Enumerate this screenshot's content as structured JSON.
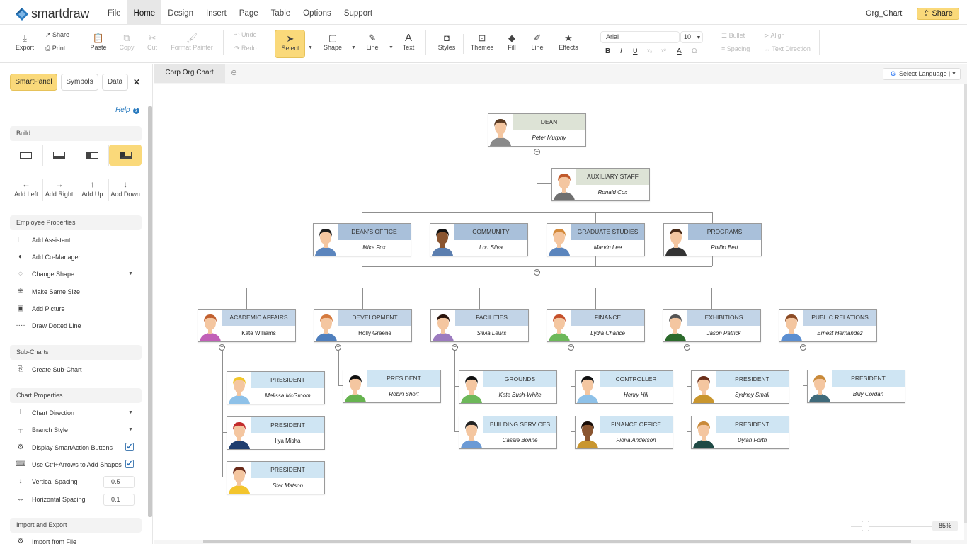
{
  "app": {
    "name": "smartdraw",
    "doc_name": "Org_Chart",
    "share_label": "Share"
  },
  "menu": [
    "File",
    "Home",
    "Design",
    "Insert",
    "Page",
    "Table",
    "Options",
    "Support"
  ],
  "menu_active": "Home",
  "toolbar": {
    "export": "Export",
    "share": "Share",
    "print": "Print",
    "paste": "Paste",
    "copy": "Copy",
    "cut": "Cut",
    "format_painter": "Format Painter",
    "undo": "Undo",
    "redo": "Redo",
    "select": "Select",
    "shape": "Shape",
    "line": "Line",
    "text": "Text",
    "styles": "Styles",
    "themes": "Themes",
    "fill": "Fill",
    "line2": "Line",
    "effects": "Effects",
    "font": "Arial",
    "font_size": "10",
    "bullet": "Bullet",
    "align": "Align",
    "spacing": "Spacing",
    "text_direction": "Text Direction"
  },
  "side": {
    "tabs": [
      "SmartPanel",
      "Symbols",
      "Data"
    ],
    "help": "Help",
    "build_label": "Build",
    "add_buttons": [
      "Add Left",
      "Add Right",
      "Add Up",
      "Add Down"
    ],
    "employee_props_label": "Employee Properties",
    "employee_items": [
      "Add Assistant",
      "Add Co-Manager",
      "Change Shape",
      "Make Same Size",
      "Add Picture",
      "Draw Dotted Line"
    ],
    "subcharts_label": "Sub-Charts",
    "subcharts_items": [
      "Create Sub-Chart"
    ],
    "chart_props_label": "Chart Properties",
    "chart_items": [
      "Chart Direction",
      "Branch Style",
      "Display SmartAction Buttons",
      "Use Ctrl+Arrows to Add Shapes",
      "Vertical Spacing",
      "Horizontal Spacing"
    ],
    "display_smartaction_checked": true,
    "ctrl_arrows_checked": true,
    "vertical_spacing": "0.5",
    "horizontal_spacing": "0.1",
    "import_export_label": "Import and Export",
    "import_item": "Import from File"
  },
  "canvas": {
    "tab": "Corp Org Chart",
    "add_tab": "+",
    "language": "Select Language",
    "zoom": "85%"
  },
  "org": {
    "dean": {
      "title": "DEAN",
      "name": "Peter Murphy"
    },
    "assistant": {
      "title": "AUXILIARY STAFF",
      "name": "Ronald Cox"
    },
    "level1": [
      {
        "title": "DEAN'S OFFICE",
        "name": "Mike Fox"
      },
      {
        "title": "COMMUNITY",
        "name": "Lou Silva"
      },
      {
        "title": "GRADUATE STUDIES",
        "name": "Marvin Lee"
      },
      {
        "title": "PROGRAMS",
        "name": "Phillip Bert"
      }
    ],
    "level2": [
      {
        "title": "ACADEMIC AFFAIRS",
        "name": "Kate Williams"
      },
      {
        "title": "DEVELOPMENT",
        "name": "Holly Greene"
      },
      {
        "title": "FACILITIES",
        "name": "Silvia Lewis"
      },
      {
        "title": "FINANCE",
        "name": "Lydia Chance"
      },
      {
        "title": "EXHIBITIONS",
        "name": "Jason Patrick"
      },
      {
        "title": "PUBLIC RELATIONS",
        "name": "Ernest Hernandez"
      }
    ],
    "level3": [
      [
        {
          "title": "PRESIDENT",
          "name": "Melissa McGroom"
        },
        {
          "title": "PRESIDENT",
          "name": "Ilya Misha"
        },
        {
          "title": "PRESIDENT",
          "name": "Star Matson"
        }
      ],
      [
        {
          "title": "PRESIDENT",
          "name": "Robin Short"
        }
      ],
      [
        {
          "title": "GROUNDS",
          "name": "Kate Bush-White"
        },
        {
          "title": "BUILDING SERVICES",
          "name": "Cassie Bonne"
        }
      ],
      [
        {
          "title": "CONTROLLER",
          "name": "Henry Hill"
        },
        {
          "title": "FINANCE OFFICE",
          "name": "Fiona Anderson"
        }
      ],
      [
        {
          "title": "PRESIDENT",
          "name": "Sydney Small"
        },
        {
          "title": "PRESIDENT",
          "name": "Dylan Forth"
        }
      ],
      [
        {
          "title": "PRESIDENT",
          "name": "Billy Cordan"
        }
      ]
    ]
  },
  "colors": {
    "accent": "#fad97a",
    "link": "#2a7bbf"
  }
}
